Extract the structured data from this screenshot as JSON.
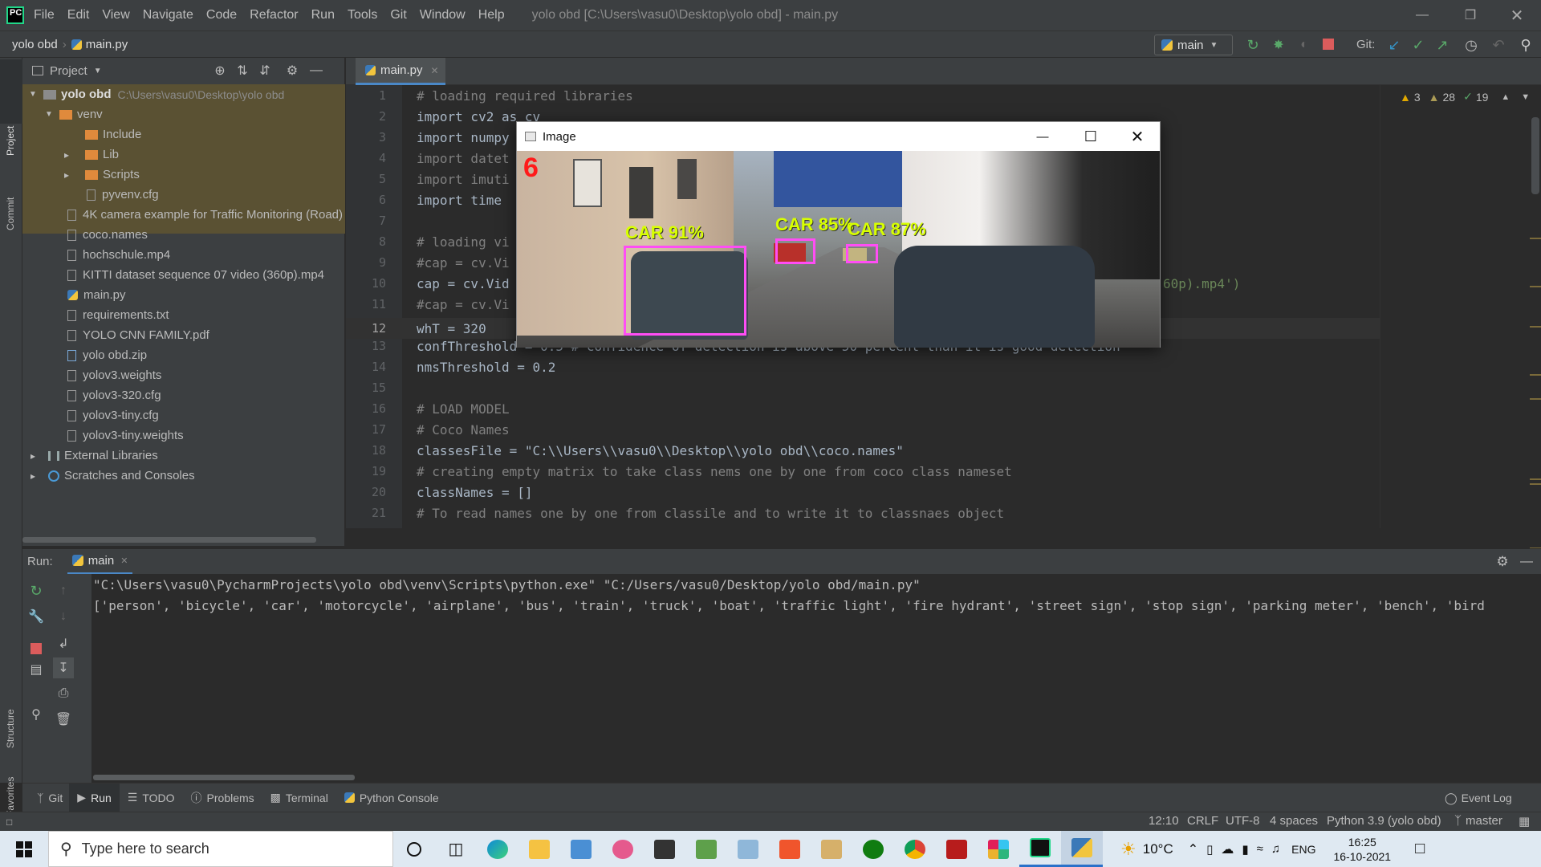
{
  "menubar": {
    "items": [
      "File",
      "Edit",
      "View",
      "Navigate",
      "Code",
      "Refactor",
      "Run",
      "Tools",
      "Git",
      "Window",
      "Help"
    ],
    "title": "yolo obd [C:\\Users\\vasu0\\Desktop\\yolo obd] - main.py"
  },
  "navbar": {
    "project": "yolo obd",
    "file": "main.py",
    "run_config": "main",
    "git_label": "Git:"
  },
  "left_tool": {
    "project": "Project",
    "commit": "Commit",
    "structure": "Structure",
    "favorites": "Favorites"
  },
  "project_panel": {
    "title": "Project",
    "tree": [
      {
        "label": "yolo obd",
        "path": "C:\\Users\\vasu0\\Desktop\\yolo obd",
        "kind": "folder-open"
      },
      {
        "label": "venv",
        "kind": "folder-open"
      },
      {
        "label": "Include",
        "kind": "folder"
      },
      {
        "label": "Lib",
        "kind": "folder"
      },
      {
        "label": "Scripts",
        "kind": "folder"
      },
      {
        "label": "pyvenv.cfg",
        "kind": "file"
      },
      {
        "label": "4K camera example for Traffic Monitoring (Road)",
        "kind": "file"
      },
      {
        "label": "coco.names",
        "kind": "file"
      },
      {
        "label": "hochschule.mp4",
        "kind": "file"
      },
      {
        "label": "KITTI dataset sequence 07 video (360p).mp4",
        "kind": "file"
      },
      {
        "label": "main.py",
        "kind": "py"
      },
      {
        "label": "requirements.txt",
        "kind": "file"
      },
      {
        "label": "YOLO CNN FAMILY.pdf",
        "kind": "file"
      },
      {
        "label": "yolo obd.zip",
        "kind": "file"
      },
      {
        "label": "yolov3.weights",
        "kind": "file"
      },
      {
        "label": "yolov3-320.cfg",
        "kind": "file"
      },
      {
        "label": "yolov3-tiny.cfg",
        "kind": "file"
      },
      {
        "label": "yolov3-tiny.weights",
        "kind": "file"
      },
      {
        "label": "External Libraries",
        "kind": "lib"
      },
      {
        "label": "Scratches and Consoles",
        "kind": "scratch"
      }
    ]
  },
  "editor": {
    "tab": "main.py",
    "inspections": {
      "warn1": "3",
      "warn2": "28",
      "ok": "19"
    },
    "line_numbers": [
      "1",
      "2",
      "3",
      "4",
      "5",
      "6",
      "7",
      "8",
      "9",
      "10",
      "11",
      "12",
      "13",
      "14",
      "15",
      "16",
      "17",
      "18",
      "19",
      "20",
      "21"
    ],
    "lines": [
      "# loading required libraries",
      "import cv2 as cv",
      "import numpy",
      "import datet",
      "import imuti",
      "import time",
      "",
      "# loading vi",
      "#cap = cv.Vi",
      "cap = cv.Vid",
      "#cap = cv.Vi",
      "whT = 320",
      "confThreshold = 0.5 # confidence of detection is above 50 percent than it is good detection",
      "nmsThreshold = 0.2",
      "",
      "# LOAD MODEL",
      "# Coco Names",
      "classesFile = \"C:\\\\Users\\\\vasu0\\\\Desktop\\\\yolo obd\\\\coco.names\"",
      "# creating empty matrix to take class nems one by one from coco class nameset",
      "classNames = []",
      "# To read names one by one from classile and to write it to classnaes object"
    ],
    "line10_tail": "60p).mp4')"
  },
  "image_window": {
    "title": "Image",
    "frame_count": "6",
    "detections": [
      {
        "label": "CAR 91%"
      },
      {
        "label": "CAR 85%"
      },
      {
        "label": "CAR 87%"
      }
    ]
  },
  "run_panel": {
    "label": "Run:",
    "tab": "main",
    "console": [
      "\"C:\\Users\\vasu0\\PycharmProjects\\yolo obd\\venv\\Scripts\\python.exe\" \"C:/Users/vasu0/Desktop/yolo obd/main.py\"",
      "['person', 'bicycle', 'car', 'motorcycle', 'airplane', 'bus', 'train', 'truck', 'boat', 'traffic light', 'fire hydrant', 'street sign', 'stop sign', 'parking meter', 'bench', 'bird"
    ]
  },
  "bottom_tabs": {
    "git": "Git",
    "run": "Run",
    "todo": "TODO",
    "problems": "Problems",
    "terminal": "Terminal",
    "python_console": "Python Console",
    "event_log": "Event Log"
  },
  "status": {
    "position": "12:10",
    "line_sep": "CRLF",
    "encoding": "UTF-8",
    "indent": "4 spaces",
    "interpreter": "Python 3.9 (yolo obd)",
    "branch": "master"
  },
  "taskbar": {
    "search_placeholder": "Type here to search",
    "temp": "10°C",
    "lang": "ENG",
    "time": "16:25",
    "date": "16-10-2021"
  },
  "colors": {
    "accent": "#3592c4",
    "keyword": "#cc7832",
    "comment": "#808080",
    "string": "#6a8759",
    "number": "#6897bb",
    "bbox": "#ff4df5",
    "label": "#d8ff00"
  }
}
